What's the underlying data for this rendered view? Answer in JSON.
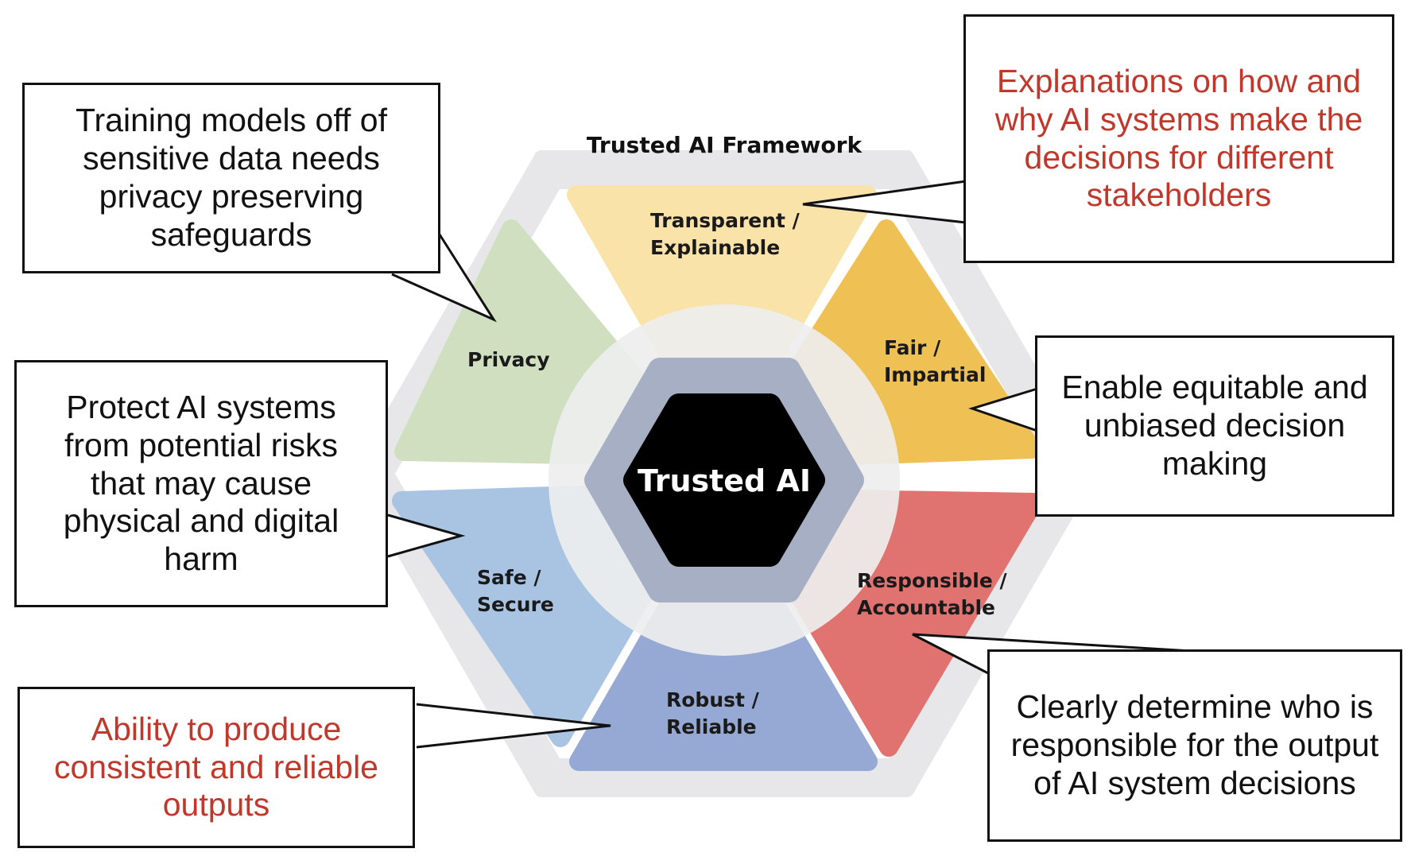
{
  "framework_title": "Trusted AI Framework",
  "core_label": "Trusted AI",
  "segments": {
    "transparent": {
      "label": "Transparent /\nExplainable",
      "color": "#f9e3a8"
    },
    "fair": {
      "label": "Fair /\nImpartial",
      "color": "#efc155"
    },
    "responsible": {
      "label": "Responsible /\nAccountable",
      "color": "#e0736f"
    },
    "robust": {
      "label": "Robust /\nReliable",
      "color": "#95a9d4"
    },
    "safe": {
      "label": "Safe /\nSecure",
      "color": "#a9c4e3"
    },
    "privacy": {
      "label": "Privacy",
      "color": "#cfdfbf"
    }
  },
  "colors": {
    "outer_ring": "#e7e7e9",
    "inner_ring": "#a6afc4",
    "core": "#000000",
    "callout_accent": "#c0382b"
  },
  "callouts": {
    "privacy": "Training models off of\nsensitive data needs\nprivacy preserving\nsafeguards",
    "transparent": "Explanations on how and\nwhy AI systems make the\ndecisions for different\nstakeholders",
    "fair": "Enable equitable and\nunbiased decision\nmaking",
    "safe": "Protect AI systems\nfrom potential risks\nthat may cause\nphysical and digital\nharm",
    "robust": "Ability to produce\nconsistent and reliable\noutputs",
    "responsible": "Clearly determine who is\nresponsible for the output\nof AI system decisions"
  }
}
